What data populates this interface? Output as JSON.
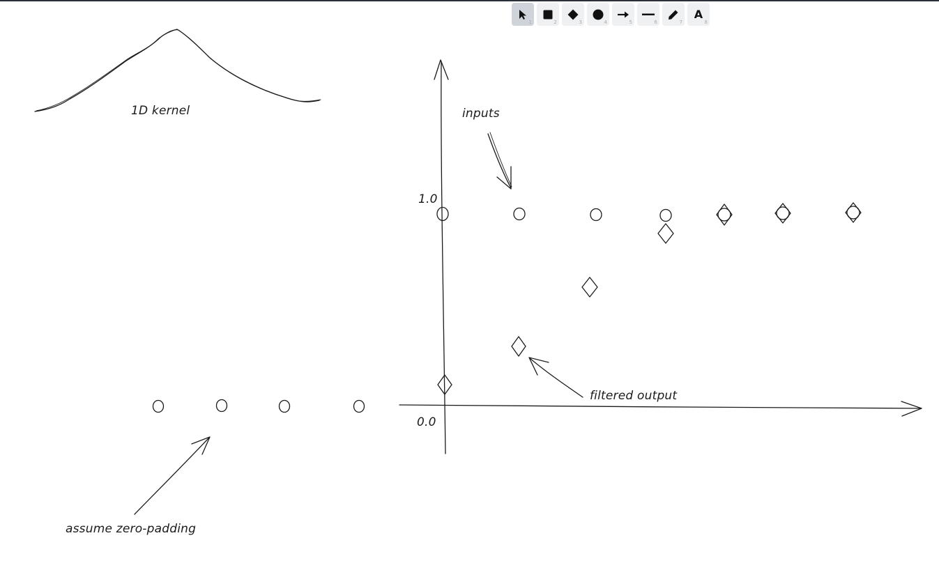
{
  "toolbar": {
    "tools": [
      {
        "name": "selection",
        "key": "1",
        "icon": "pointer-icon",
        "active": true
      },
      {
        "name": "rectangle",
        "key": "2",
        "icon": "square-icon"
      },
      {
        "name": "diamond",
        "key": "3",
        "icon": "diamond-icon"
      },
      {
        "name": "ellipse",
        "key": "4",
        "icon": "circle-icon"
      },
      {
        "name": "arrow",
        "key": "5",
        "icon": "arrow-right-icon"
      },
      {
        "name": "line",
        "key": "6",
        "icon": "line-icon"
      },
      {
        "name": "draw",
        "key": "7",
        "icon": "pencil-icon"
      },
      {
        "name": "text",
        "key": "8",
        "icon": "text-icon",
        "glyph": "A"
      }
    ]
  },
  "drawing": {
    "kernel_label": "1D kernel",
    "inputs_label": "inputs",
    "y_tick_top": "1.0",
    "y_tick_bottom": "0.0",
    "filtered_label": "filtered output",
    "padding_label": "assume zero-padding"
  },
  "colors": {
    "stroke": "#1b1b1b",
    "toolbar_bg": "#eef0f2",
    "toolbar_active": "#ced4da"
  }
}
